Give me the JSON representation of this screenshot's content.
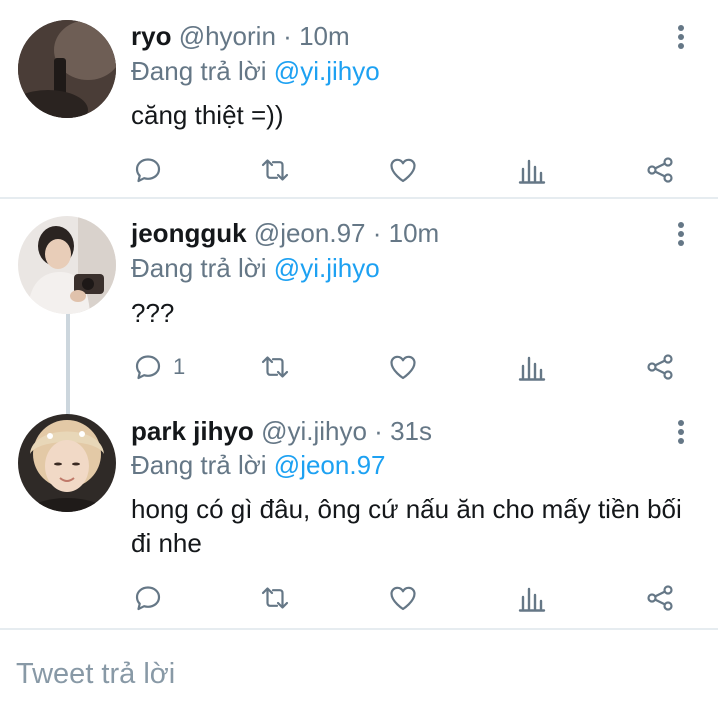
{
  "tweets": [
    {
      "name": "ryo",
      "handle": "@hyorin",
      "dot": "·",
      "time": "10m",
      "reply_prefix": "Đang trả lời",
      "reply_to": "@yi.jihyo",
      "text": "căng thiệt =))",
      "reply_count": ""
    },
    {
      "name": "jeongguk",
      "handle": "@jeon.97",
      "dot": "·",
      "time": "10m",
      "reply_prefix": "Đang trả lời",
      "reply_to": "@yi.jihyo",
      "text": "???",
      "reply_count": "1"
    },
    {
      "name": "park jihyo",
      "handle": "@yi.jihyo",
      "dot": "·",
      "time": "31s",
      "reply_prefix": "Đang trả lời",
      "reply_to": "@jeon.97",
      "text": "hong có gì đâu, ông cứ nấu ăn cho mấy tiền bối đi nhe",
      "reply_count": ""
    }
  ],
  "composer": {
    "placeholder": "Tweet trả lời"
  },
  "icons": {
    "reply": "reply-icon",
    "retweet": "retweet-icon",
    "like": "heart-icon",
    "analytics": "analytics-icon",
    "share": "share-icon",
    "more": "more-vertical-icon"
  },
  "colors": {
    "mention": "#1da1f2",
    "secondary_text": "#657786",
    "icon": "#657786",
    "divider": "#e6ecf0",
    "thread_line": "#ccd6dd"
  }
}
